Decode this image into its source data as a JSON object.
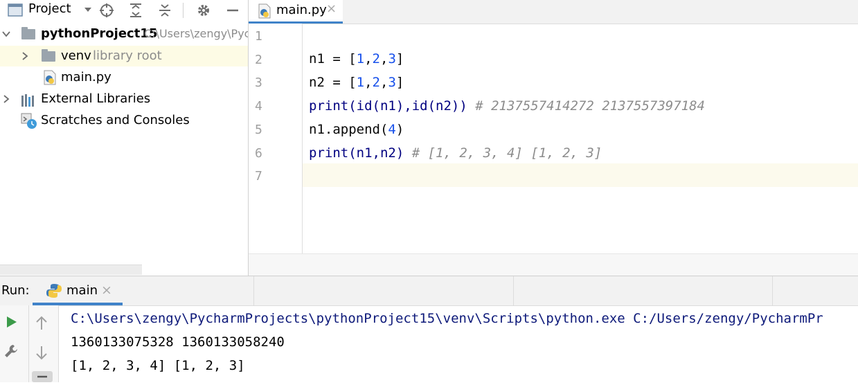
{
  "project_panel": {
    "title": "Project",
    "tree": [
      {
        "name": "pythonProject15",
        "hint": "C:\\Users\\zengy\\Pyc"
      },
      {
        "name": "venv",
        "hint": "library root"
      },
      {
        "name": "main.py",
        "hint": ""
      },
      {
        "name": "External Libraries",
        "hint": ""
      },
      {
        "name": "Scratches and Consoles",
        "hint": ""
      }
    ]
  },
  "editor": {
    "tab": "main.py",
    "line_numbers": [
      "1",
      "2",
      "3",
      "4",
      "5",
      "6",
      "7"
    ],
    "code": {
      "l2": {
        "a": "n1 = [",
        "n1": "1",
        "c1": ",",
        "n2": "2",
        "c2": ",",
        "n3": "3",
        "b": "]"
      },
      "l3": {
        "a": "n2 = [",
        "n1": "1",
        "c1": ",",
        "n2": "2",
        "c2": ",",
        "n3": "3",
        "b": "]"
      },
      "l4": {
        "code": "print(id(n1),id(n2))",
        "comment": "# 2137557414272 2137557397184"
      },
      "l5": {
        "a": "n1.append(",
        "n": "4",
        "b": ")"
      },
      "l6": {
        "code": "print(n1,n2)",
        "comment": "# [1, 2, 3, 4] [1, 2, 3]"
      }
    }
  },
  "run_panel": {
    "label": "Run:",
    "tab": "main",
    "output": [
      "C:\\Users\\zengy\\PycharmProjects\\pythonProject15\\venv\\Scripts\\python.exe C:/Users/zengy/PycharmPr",
      "1360133075328 1360133058240",
      "[1, 2, 3, 4] [1, 2, 3]"
    ]
  },
  "colors": {
    "accent": "#4083c9",
    "number": "#1750eb",
    "comment": "#8c8c8c",
    "selection": "#fdfbe5"
  }
}
